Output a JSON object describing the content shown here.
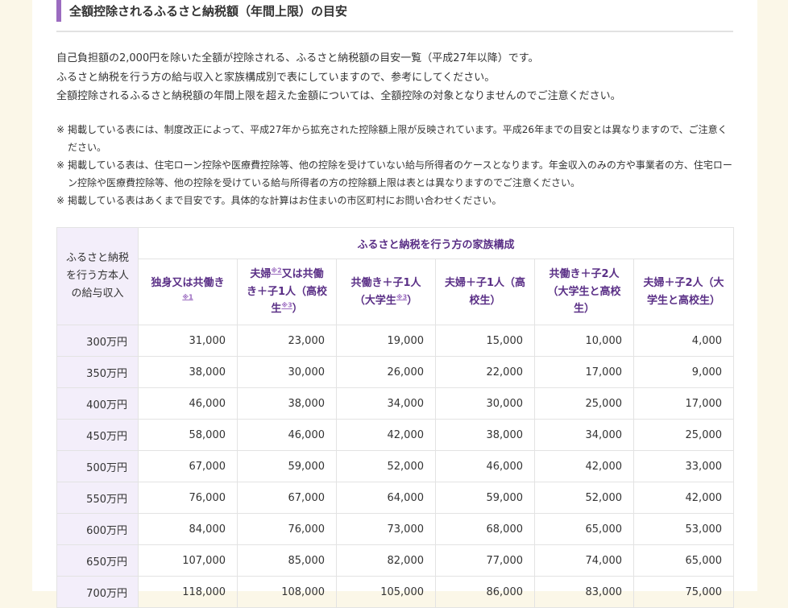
{
  "section_title": "全額控除されるふるさと納税額（年間上限）の目安",
  "intro": [
    "自己負担額の2,000円を除いた全額が控除される、ふるさと納税額の目安一覧（平成27年以降）です。",
    "ふるさと納税を行う方の給与収入と家族構成別で表にしていますので、参考にしてください。",
    "全額控除されるふるさと納税額の年間上限を超えた金額については、全額控除の対象となりませんのでご注意ください。"
  ],
  "notes": {
    "mark": "※",
    "items": [
      "掲載している表には、制度改正によって、平成27年から拡充された控除額上限が反映されています。平成26年までの目安とは異なりますので、ご注意ください。",
      "掲載している表は、住宅ローン控除や医療費控除等、他の控除を受けていない給与所得者のケースとなります。年金収入のみの方や事業者の方、住宅ローン控除や医療費控除等、他の控除を受けている給与所得者の方の控除額上限は表とは異なりますのでご注意ください。",
      "掲載している表はあくまで目安です。具体的な計算はお住まいの市区町村にお問い合わせください。"
    ]
  },
  "table": {
    "income_header": "ふるさと納税を行う方本人の給与収入",
    "family_header": "ふるさと納税を行う方の家族構成",
    "columns": {
      "c1": {
        "a": "独身又は共働き",
        "ref": "※1"
      },
      "c2": {
        "a": "夫婦",
        "ref": "※2",
        "b": "又は共働き＋子1人（高校生",
        "ref2": "※3",
        "c": "）"
      },
      "c3": {
        "a": "共働き＋子1人（大学生",
        "ref": "※3",
        "b": "）"
      },
      "c4": "夫婦＋子1人（高校生）",
      "c5": "共働き＋子2人（大学生と高校生）",
      "c6": "夫婦＋子2人（大学生と高校生）"
    },
    "rows": [
      {
        "income": "300万円",
        "values": [
          "31,000",
          "23,000",
          "19,000",
          "15,000",
          "10,000",
          "4,000"
        ]
      },
      {
        "income": "350万円",
        "values": [
          "38,000",
          "30,000",
          "26,000",
          "22,000",
          "17,000",
          "9,000"
        ]
      },
      {
        "income": "400万円",
        "values": [
          "46,000",
          "38,000",
          "34,000",
          "30,000",
          "25,000",
          "17,000"
        ]
      },
      {
        "income": "450万円",
        "values": [
          "58,000",
          "46,000",
          "42,000",
          "38,000",
          "34,000",
          "25,000"
        ]
      },
      {
        "income": "500万円",
        "values": [
          "67,000",
          "59,000",
          "52,000",
          "46,000",
          "42,000",
          "33,000"
        ]
      },
      {
        "income": "550万円",
        "values": [
          "76,000",
          "67,000",
          "64,000",
          "59,000",
          "52,000",
          "42,000"
        ]
      },
      {
        "income": "600万円",
        "values": [
          "84,000",
          "76,000",
          "73,000",
          "68,000",
          "65,000",
          "53,000"
        ]
      },
      {
        "income": "650万円",
        "values": [
          "107,000",
          "85,000",
          "82,000",
          "77,000",
          "74,000",
          "65,000"
        ]
      },
      {
        "income": "700万円",
        "values": [
          "118,000",
          "108,000",
          "105,000",
          "86,000",
          "83,000",
          "75,000"
        ]
      }
    ]
  }
}
